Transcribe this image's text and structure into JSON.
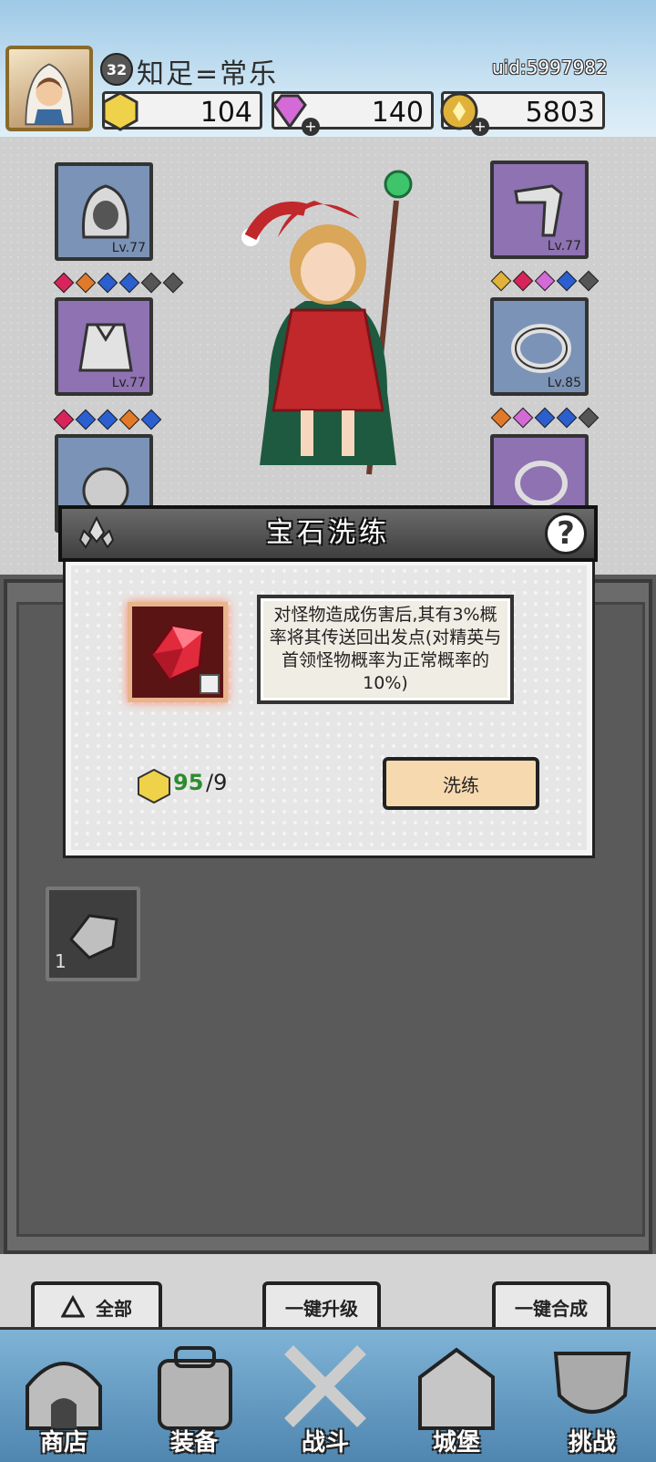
{
  "player": {
    "level": "32",
    "name": "知足=常乐",
    "uid": "uid:5997982"
  },
  "currencies": [
    {
      "name": "gold-gem",
      "value": "104",
      "color": "#f0d24a"
    },
    {
      "name": "diamond",
      "value": "140",
      "color": "#d36ad6"
    },
    {
      "name": "coin",
      "value": "5803",
      "color": "#e0b23a"
    }
  ],
  "equipment": {
    "left": [
      {
        "icon": "hood-icon",
        "level": "Lv.77",
        "gems": [
          "#d8245a",
          "#e07a2a",
          "#2b5fd0",
          "#2b5fd0",
          "#555555",
          "#555555"
        ]
      },
      {
        "icon": "cape-icon",
        "level": "Lv.77",
        "gems": [
          "#d8245a",
          "#2b5fd0",
          "#2b5fd0",
          "#e07a2a",
          "#2b5fd0"
        ]
      },
      {
        "icon": "pouch-icon",
        "level": ""
      }
    ],
    "right": [
      {
        "icon": "gauntlet-icon",
        "level": "Lv.77",
        "gems": [
          "#e0b23a",
          "#d8245a",
          "#d36ad6",
          "#2b5fd0",
          "#555555"
        ]
      },
      {
        "icon": "ring-icon",
        "level": "Lv.85",
        "gems": [
          "#e07a2a",
          "#d36ad6",
          "#2b5fd0",
          "#2b5fd0",
          "#555555"
        ]
      },
      {
        "icon": "necklace-icon",
        "level": ""
      }
    ]
  },
  "inventory": {
    "item_count": "1"
  },
  "toolbar": {
    "filter_label": "全部",
    "upgrade_all_label": "一键升级",
    "merge_all_label": "一键合成"
  },
  "nav": [
    {
      "label": "商店",
      "icon": "shop-icon"
    },
    {
      "label": "装备",
      "icon": "bag-icon"
    },
    {
      "label": "战斗",
      "icon": "swords-icon"
    },
    {
      "label": "城堡",
      "icon": "castle-icon"
    },
    {
      "label": "挑战",
      "icon": "shield-icon"
    }
  ],
  "dialog": {
    "title": "宝石洗练",
    "help": "?",
    "description": "对怪物造成伤害后,其有3%概率将其传送回出发点(对精英与首领怪物概率为正常概率的10%)",
    "cost_have": "95",
    "cost_need": "/9",
    "refine_label": "洗练",
    "accent_color": "#2e8b2e"
  }
}
